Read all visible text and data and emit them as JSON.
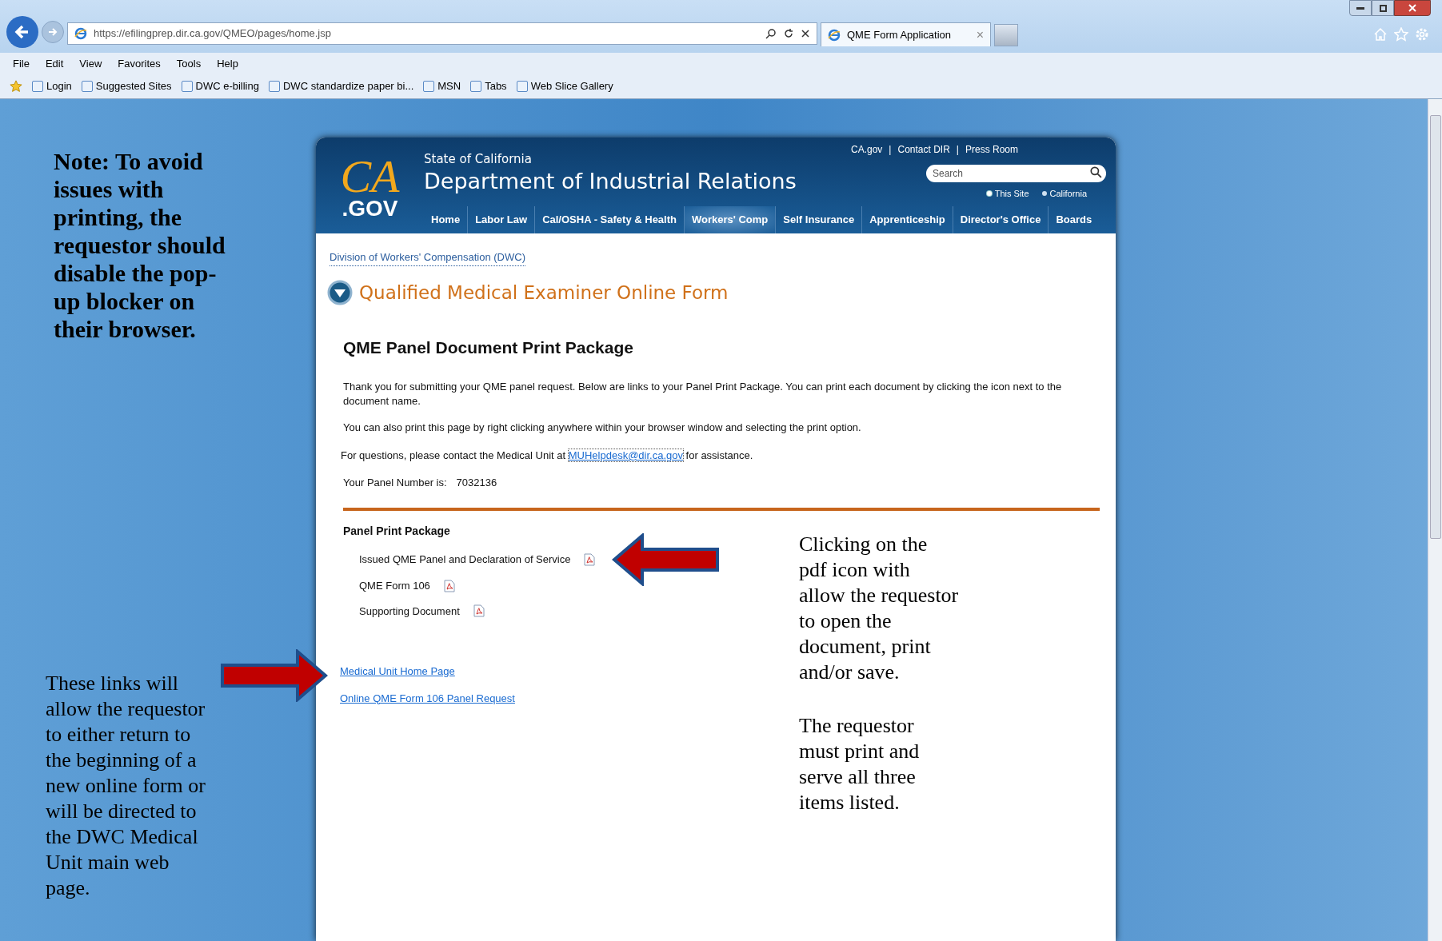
{
  "browser": {
    "address": "https://efilingprep.dir.ca.gov/QMEO/pages/home.jsp",
    "tab": {
      "title": "QME Form Application",
      "close": "×"
    },
    "menu": [
      "File",
      "Edit",
      "View",
      "Favorites",
      "Tools",
      "Help"
    ],
    "favorites": [
      "Login",
      "Suggested Sites",
      "DWC e-billing",
      "DWC standardize paper bi...",
      "MSN",
      "Tabs",
      "Web Slice Gallery"
    ]
  },
  "site": {
    "logo_top": "CA",
    "logo_bottom": ".GOV",
    "state": "State of California",
    "department": "Department of Industrial Relations",
    "top_links": [
      "CA.gov",
      "Contact DIR",
      "Press Room"
    ],
    "separator": "|",
    "search": {
      "placeholder": "Search"
    },
    "scopes": [
      {
        "label": "This Site",
        "selected": true
      },
      {
        "label": "California",
        "selected": false
      }
    ],
    "nav": [
      {
        "label": "Home",
        "selected": false
      },
      {
        "label": "Labor Law",
        "selected": false
      },
      {
        "label": "Cal/OSHA - Safety & Health",
        "selected": false
      },
      {
        "label": "Workers' Comp",
        "selected": true
      },
      {
        "label": "Self Insurance",
        "selected": false
      },
      {
        "label": "Apprenticeship",
        "selected": false
      },
      {
        "label": "Director's Office",
        "selected": false
      },
      {
        "label": "Boards",
        "selected": false
      }
    ],
    "breadcrumb": "Division of Workers' Compensation (DWC)",
    "form_title": "Qualified Medical Examiner Online Form",
    "heading": "QME Panel Document Print Package",
    "paragraphs": [
      "Thank you for submitting your QME panel request. Below are links to your Panel Print Package. You can print each document by clicking the icon next to the document name.",
      "You can also print this page by right clicking anywhere within your browser window and selecting the print option."
    ],
    "contact": {
      "before": "For questions, please contact the Medical Unit at",
      "email": "MUHelpdesk@dir.ca.gov",
      "after": "for assistance."
    },
    "panel_number": {
      "label": "Your Panel Number is:",
      "value": "7032136"
    },
    "package_title": "Panel Print Package",
    "documents": [
      "Issued QME Panel and Declaration of Service",
      "QME Form 106",
      "Supporting Document"
    ],
    "links": [
      "Medical Unit Home Page",
      "Online QME Form 106 Panel Request"
    ]
  },
  "annotations": {
    "note": "Note: To avoid issues with printing, the requestor should disable the pop-up blocker on their browser.",
    "links_note": "These links will allow the requestor to either return to the beginning of a new online form or will be directed to the DWC Medical Unit main web page.",
    "pdf_note": "Clicking on the pdf icon with allow the requestor to open the document, print and/or save.",
    "serve_note": "The requestor must print and serve all three items listed."
  }
}
